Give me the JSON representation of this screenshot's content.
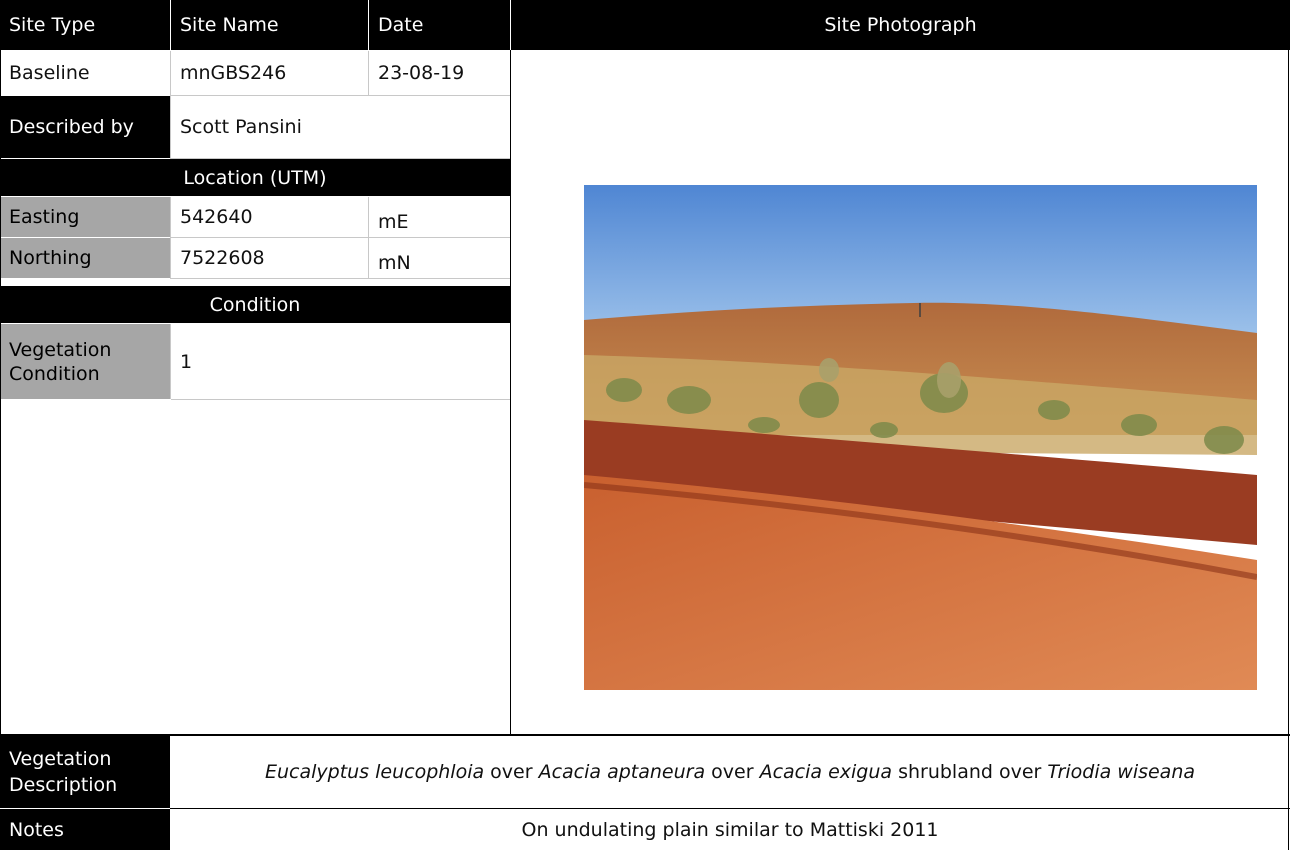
{
  "headers": {
    "site_type": "Site Type",
    "site_name": "Site Name",
    "date": "Date",
    "site_photograph": "Site Photograph"
  },
  "site": {
    "type": "Baseline",
    "name": "mnGBS246",
    "date": "23-08-19"
  },
  "described_by": {
    "label": "Described by",
    "value": "Scott Pansini"
  },
  "location": {
    "heading": "Location (UTM)",
    "easting": {
      "label": "Easting",
      "value": "542640",
      "unit": "mE"
    },
    "northing": {
      "label": "Northing",
      "value": "7522608",
      "unit": "mN"
    }
  },
  "condition": {
    "heading": "Condition",
    "label": "Vegetation Condition",
    "value": "1"
  },
  "vegetation_description": {
    "label": "Vegetation Description",
    "parts": [
      {
        "text": "Eucalyptus leucophloia",
        "italic": true
      },
      {
        "text": " over ",
        "italic": false
      },
      {
        "text": "Acacia aptaneura",
        "italic": true
      },
      {
        "text": " over ",
        "italic": false
      },
      {
        "text": "Acacia exigua",
        "italic": true
      },
      {
        "text": " shrubland over ",
        "italic": false
      },
      {
        "text": "Triodia wiseana",
        "italic": true
      }
    ]
  },
  "notes": {
    "label": "Notes",
    "value": "On undulating plain similar to Mattiski 2011"
  },
  "colors": {
    "header_bg": "#000000",
    "label_bg": "#a6a6a6",
    "sky": "#5b8fd6",
    "soil": "#c0502a"
  }
}
